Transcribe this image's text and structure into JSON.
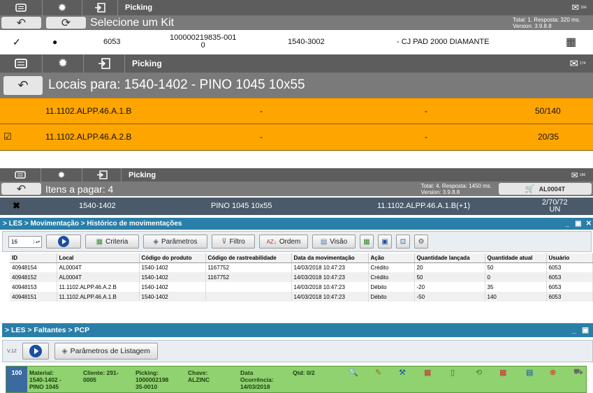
{
  "s1": {
    "app_title": "Picking",
    "badge": "166",
    "page_title": "Selecione um Kit",
    "status_total": "Total: 1. Resposta: 320 ms.",
    "status_version": "Version: 3.9.8.8",
    "row": {
      "qty": "6053",
      "code_line1": "100000219835-001",
      "code_line2": "0",
      "ref": "1540-3002",
      "desc": "- CJ PAD 2000 DIAMANTE"
    }
  },
  "s2": {
    "app_title": "Picking",
    "badge": "174",
    "page_title": "Locais para: 1540-1402 - PINO 1045 10x55",
    "rows": [
      {
        "loc": "11.1102.ALPP.46.A.1.B",
        "c1": "-",
        "c2": "-",
        "qty": "50/140",
        "checked": false
      },
      {
        "loc": "11.1102.ALPP.46.A.2.B",
        "c1": "-",
        "c2": "-",
        "qty": "20/35",
        "checked": true
      }
    ]
  },
  "s3": {
    "app_title": "Picking",
    "badge": "166",
    "page_title": "Itens a pagar: 4",
    "status_total": "Total: 4. Resposta: 1450 ms.",
    "status_version": "Version: 3.9.8.8",
    "cart_label": "AL0004T",
    "row": {
      "code": "1540-1402",
      "desc": "PINO 1045 10x55",
      "loc": "11.1102.ALPP.46.A.1.B(+1)",
      "qty_line1": "2/70/72",
      "qty_line2": "UN"
    }
  },
  "s4": {
    "breadcrumb": "> LES > Movimentação > Histórico de movimentações",
    "page_size": "16",
    "tools": {
      "criteria": "Criteria",
      "params": "Parâmetros",
      "filter": "Filtro",
      "order": "Ordem",
      "view": "Visão"
    },
    "columns": [
      "ID",
      "Local",
      "Código do produto",
      "Código de rastreabilidade",
      "Data da movimentação",
      "Ação",
      "Quantidade lançada",
      "Quantidade atual",
      "Usuário"
    ],
    "rows": [
      [
        "40948154",
        "AL0004T",
        "1540-1402",
        "1167752",
        "14/03/2018 10:47:23",
        "Crédito",
        "20",
        "50",
        "6053"
      ],
      [
        "40948152",
        "AL0004T",
        "1540-1402",
        "1167752",
        "14/03/2018 10:47:23",
        "Crédito",
        "50",
        "0",
        "6053"
      ],
      [
        "40948153",
        "11.1102.ALPP.46.A.2.B",
        "1540-1402",
        "",
        "14/03/2018 10:47:23",
        "Débito",
        "-20",
        "35",
        "6053"
      ],
      [
        "40948151",
        "11.1102.ALPP.46.A.1.B",
        "1540-1402",
        "",
        "14/03/2018 10:47:23",
        "Débito",
        "-50",
        "140",
        "6053"
      ]
    ]
  },
  "s5": {
    "breadcrumb": "> LES > Faltantes > PCP",
    "version": "V.12",
    "params_label": "Parâmetros de Listagem",
    "card": {
      "num": "100",
      "material_l": "Material:",
      "material_v1": "1540-1402 -",
      "material_v2": "PINO 1045",
      "cliente_l": "Cliente: 291-",
      "cliente_v": "0005",
      "picking_l": "Picking:",
      "picking_v1": "1000002198",
      "picking_v2": "35-0010",
      "chave_l": "Chave:",
      "chave_v": "ALZINC",
      "data_l": "Data",
      "data_l2": "Ocorrência:",
      "data_v": "14/03/2018",
      "qtd": "Qtd: 0/2"
    }
  }
}
